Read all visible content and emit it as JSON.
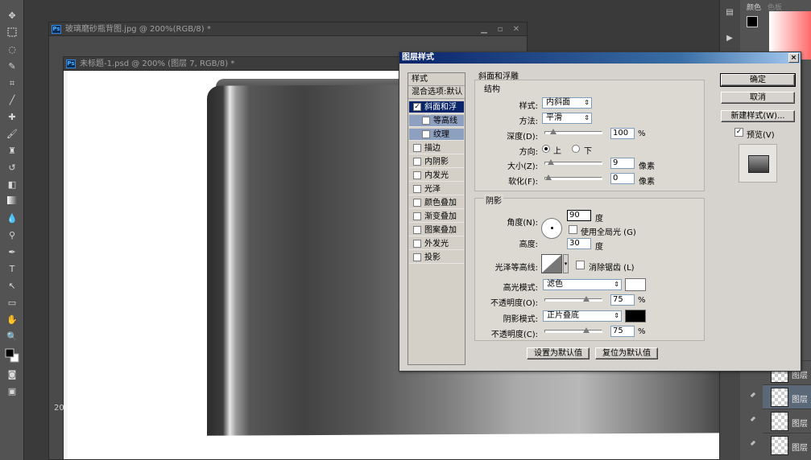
{
  "right_panel": {
    "tab_color": "颜色",
    "tab_swatches": "色板",
    "layer_label": "图层"
  },
  "doc_back": {
    "title": "玻璃磨砂瓶背图.jpg @ 200%(RGB/8) *"
  },
  "doc_front": {
    "title": "未标题-1.psd @ 200% (图层 7, RGB/8) *",
    "zoom": "20"
  },
  "dialog": {
    "title": "图层样式",
    "close": "×",
    "styles_header": "样式",
    "blend_options": "混合选项:默认",
    "style_items": [
      {
        "label": "斜面和浮雕",
        "checked": true
      },
      {
        "label": "等高线",
        "checked": false
      },
      {
        "label": "纹理",
        "checked": false
      },
      {
        "label": "描边",
        "checked": false
      },
      {
        "label": "内阴影",
        "checked": false
      },
      {
        "label": "内发光",
        "checked": false
      },
      {
        "label": "光泽",
        "checked": false
      },
      {
        "label": "颜色叠加",
        "checked": false
      },
      {
        "label": "渐变叠加",
        "checked": false
      },
      {
        "label": "图案叠加",
        "checked": false
      },
      {
        "label": "外发光",
        "checked": false
      },
      {
        "label": "投影",
        "checked": false
      }
    ],
    "section_title": "斜面和浮雕",
    "structure": {
      "title": "结构",
      "style_label": "样式:",
      "style_value": "内斜面",
      "technique_label": "方法:",
      "technique_value": "平滑",
      "depth_label": "深度(D):",
      "depth_value": "100",
      "depth_unit": "%",
      "depth_level": 0.1,
      "direction_label": "方向:",
      "direction_up": "上",
      "direction_down": "下",
      "size_label": "大小(Z):",
      "size_value": "9",
      "size_unit": "像素",
      "size_level": 0.05,
      "soften_label": "软化(F):",
      "soften_value": "0",
      "soften_unit": "像素",
      "soften_level": 0
    },
    "shading": {
      "title": "阴影",
      "angle_label": "角度(N):",
      "angle_value": "90",
      "angle_unit": "度",
      "global_light_label": "使用全局光 (G)",
      "altitude_label": "高度:",
      "altitude_value": "30",
      "altitude_unit": "度",
      "gloss_label": "光泽等高线:",
      "antialias_label": "消除锯齿 (L)",
      "highlight_label": "高光模式:",
      "highlight_value": "滤色",
      "highlight_color": "#ffffff",
      "hl_opacity_label": "不透明度(O):",
      "hl_opacity_value": "75",
      "hl_opacity_unit": "%",
      "hl_opacity_level": 0.75,
      "shadow_label": "阴影模式:",
      "shadow_value": "正片叠底",
      "shadow_color": "#000000",
      "sh_opacity_label": "不透明度(C):",
      "sh_opacity_value": "75",
      "sh_opacity_unit": "%",
      "sh_opacity_level": 0.75
    },
    "make_default": "设置为默认值",
    "reset_default": "复位为默认值",
    "ok": "确定",
    "cancel": "取消",
    "new_style": "新建样式(W)...",
    "preview": "预览(V)"
  }
}
